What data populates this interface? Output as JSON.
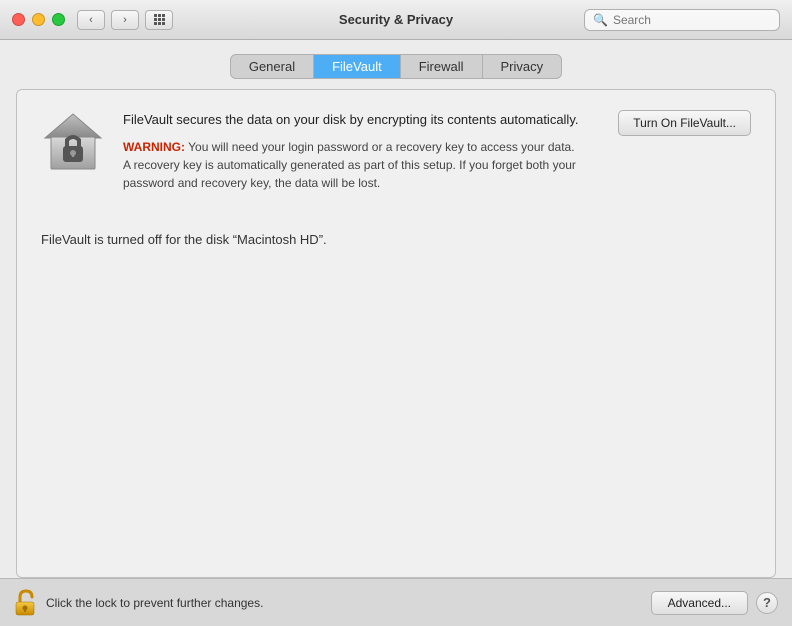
{
  "titlebar": {
    "title": "Security & Privacy",
    "search_placeholder": "Search"
  },
  "tabs": {
    "items": [
      {
        "id": "general",
        "label": "General",
        "active": false
      },
      {
        "id": "filevault",
        "label": "FileVault",
        "active": true
      },
      {
        "id": "firewall",
        "label": "Firewall",
        "active": false
      },
      {
        "id": "privacy",
        "label": "Privacy",
        "active": false
      }
    ]
  },
  "filevault": {
    "description": "FileVault secures the data on your disk by encrypting its contents automatically.",
    "warning_label": "WARNING:",
    "warning_text": " You will need your login password or a recovery key to access your data. A recovery key is automatically generated as part of this setup. If you forget both your password and recovery key, the data will be lost.",
    "turn_on_button": "Turn On FileVault...",
    "status_text": "FileVault is turned off for the disk “Macintosh HD”."
  },
  "bottom": {
    "lock_label": "Click the lock to prevent further changes.",
    "advanced_button": "Advanced...",
    "help_button": "?"
  }
}
